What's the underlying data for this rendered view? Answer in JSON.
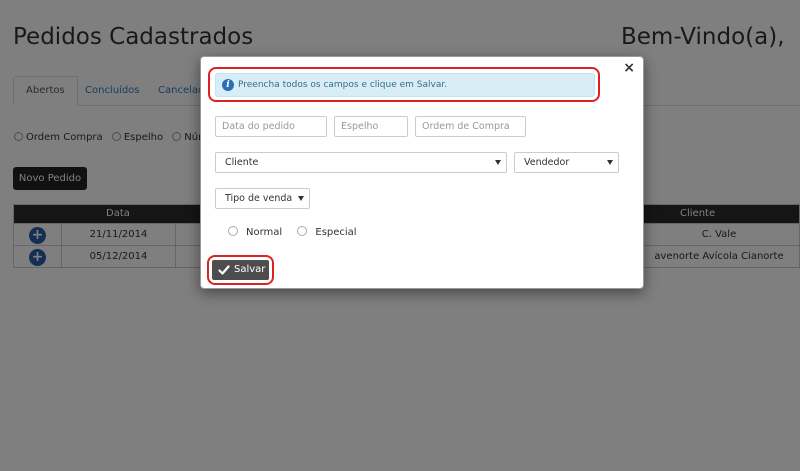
{
  "page": {
    "title": "Pedidos Cadastrados",
    "welcome": "Bem-Vindo(a),"
  },
  "tabs": [
    {
      "label": "Abertos"
    },
    {
      "label": "Concluídos"
    },
    {
      "label": "Cancelad"
    }
  ],
  "filters": [
    {
      "label": "Ordem Compra"
    },
    {
      "label": "Espelho"
    },
    {
      "label": "Númer"
    }
  ],
  "new_order_button": "Novo Pedido",
  "table": {
    "headers": {
      "date": "Data",
      "client": "Cliente"
    },
    "rows": [
      {
        "date": "21/11/2014",
        "client": "C. Vale"
      },
      {
        "date": "05/12/2014",
        "client": "avenorte Avícola Cianorte"
      }
    ]
  },
  "modal": {
    "close_label": "×",
    "alert": "Preencha todos os campos e clique em Salvar.",
    "info_icon_glyph": "i",
    "fields": {
      "data_pedido_placeholder": "Data do pedido",
      "espelho_placeholder": "Espelho",
      "ordem_compra_placeholder": "Ordem de Compra",
      "cliente_value": "Cliente",
      "vendedor_value": "Vendedor",
      "tipo_venda_value": "Tipo de venda"
    },
    "radio_options": [
      {
        "label": "Normal"
      },
      {
        "label": "Especial"
      }
    ],
    "save_label": "Salvar"
  },
  "colors": {
    "highlight_ring": "#dd2222",
    "alert_bg": "#d9edf7",
    "save_button": "#4d4d4d",
    "table_header": "#2b2b2b"
  }
}
